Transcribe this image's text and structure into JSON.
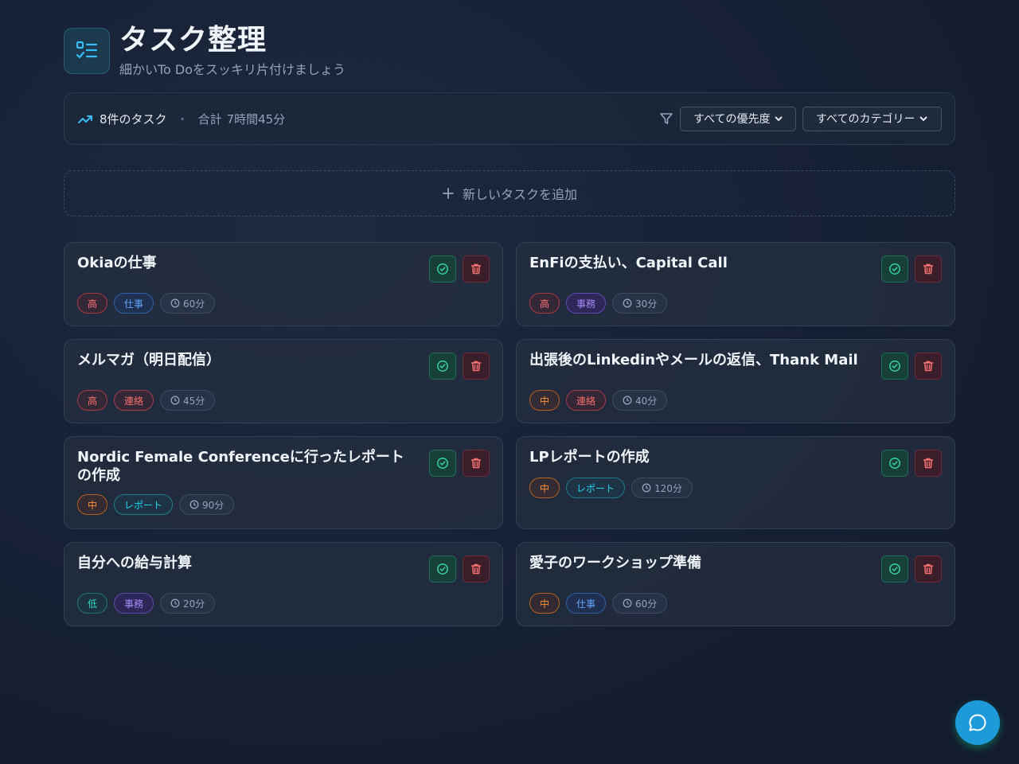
{
  "header": {
    "title": "タスク整理",
    "subtitle": "細かいTo Doをスッキリ片付けましょう"
  },
  "toolbar": {
    "count": "8件のタスク",
    "separator": "・",
    "total_label": "合計",
    "total": "7時間45分",
    "priority_filter": "すべての優先度",
    "category_filter": "すべてのカテゴリー"
  },
  "add_task_label": "新しいタスクを追加",
  "tasks": [
    {
      "title": "Okiaの仕事",
      "priority": "高",
      "category": "仕事",
      "time": "60分"
    },
    {
      "title": "EnFiの支払い、Capital Call",
      "priority": "高",
      "category": "事務",
      "time": "30分"
    },
    {
      "title": "メルマガ（明日配信）",
      "priority": "高",
      "category": "連絡",
      "time": "45分"
    },
    {
      "title": "出張後のLinkedinやメールの返信、Thank Mail",
      "priority": "中",
      "category": "連絡",
      "time": "40分"
    },
    {
      "title": "Nordic Female Conferenceに行ったレポートの作成",
      "priority": "中",
      "category": "レポート",
      "time": "90分"
    },
    {
      "title": "LPレポートの作成",
      "priority": "中",
      "category": "レポート",
      "time": "120分"
    },
    {
      "title": "自分への給与計算",
      "priority": "低",
      "category": "事務",
      "time": "20分"
    },
    {
      "title": "愛子のワークショップ準備",
      "priority": "中",
      "category": "仕事",
      "time": "60分"
    }
  ],
  "icons": {
    "logo": "checklist-icon",
    "stats": "trending-up-icon",
    "filter": "filter-icon",
    "complete": "check-circle-icon",
    "delete": "trash-icon",
    "time": "clock-icon",
    "chat": "chat-bubble-icon"
  },
  "colors": {
    "accent": "#1d9bd8",
    "priority_high": "#f87171",
    "priority_mid": "#fb923c",
    "priority_low": "#2dd4bf",
    "category_work": "#60a5fa",
    "category_admin": "#a78bfa",
    "category_contact": "#f87171",
    "category_report": "#22d3ee"
  }
}
